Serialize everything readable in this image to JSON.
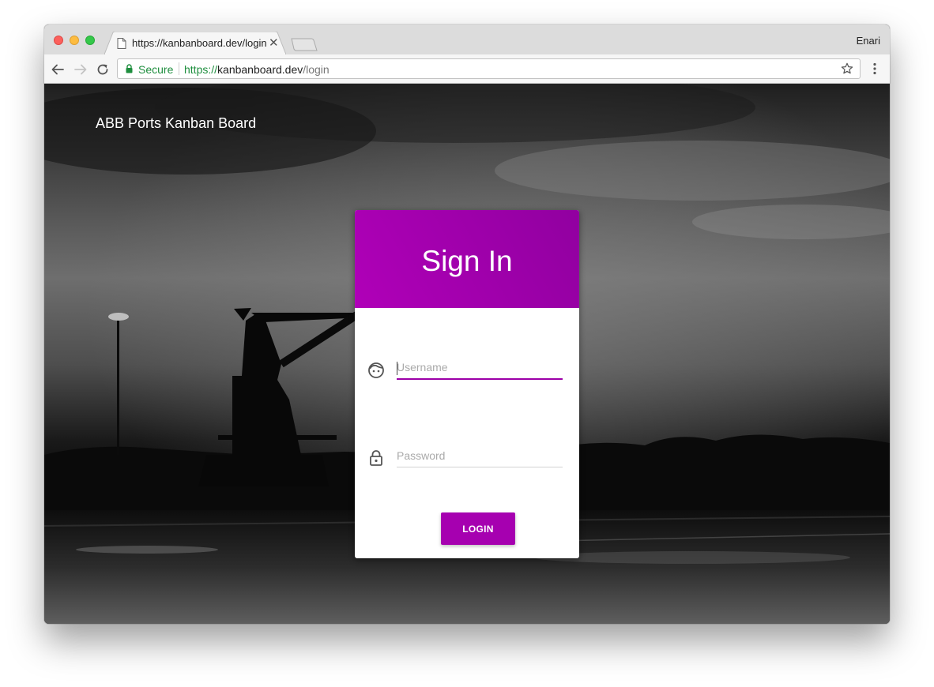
{
  "browser": {
    "tab_title": "https://kanbanboard.dev/login",
    "profile_name": "Enari",
    "security_label": "Secure",
    "url": {
      "scheme": "https://",
      "host": "kanbanboard.dev",
      "path": "/login"
    }
  },
  "page": {
    "brand_title": "ABB Ports Kanban Board",
    "login_card": {
      "title": "Sign In",
      "username": {
        "placeholder": "Username",
        "value": "",
        "icon": "face-icon"
      },
      "password": {
        "placeholder": "Password",
        "value": "",
        "icon": "lock-outline-icon"
      },
      "submit_label": "LOGIN"
    }
  },
  "colors": {
    "accent": "#a600b0",
    "header_start": "#b000b8",
    "header_end": "#9100a0",
    "secure_green": "#1e8e3e"
  }
}
